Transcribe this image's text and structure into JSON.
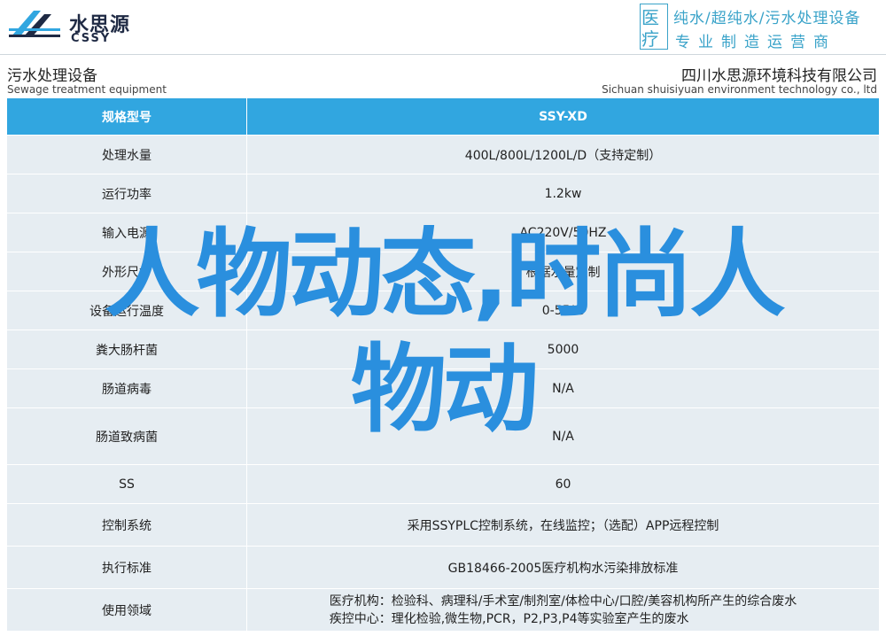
{
  "brand": {
    "name_cn": "水思源",
    "name_en": "CSSY",
    "seal_text": [
      "医",
      "疗"
    ],
    "tagline_1": "纯水/超纯水/污水处理设备",
    "tagline_2": "专业制造运营商"
  },
  "product_header": {
    "title_cn": "污水处理设备",
    "title_en": "Sewage treatment equipment",
    "company_cn": "四川水思源环境科技有限公司",
    "company_en": "Sichuan shuisiyuan environment technology co., ltd"
  },
  "table": {
    "header": [
      "规格型号",
      "SSY-XD"
    ],
    "rows": [
      [
        "处理水量",
        "400L/800L/1200L/D（支持定制）"
      ],
      [
        "运行功率",
        "1.2kw"
      ],
      [
        "输入电源",
        "AC220V/50HZ"
      ],
      [
        "外形尺寸",
        "根据水量定制"
      ],
      [
        "设备运行温度",
        "0-55℃"
      ],
      [
        "粪大肠杆菌",
        "5000"
      ],
      [
        "肠道病毒",
        "N/A"
      ],
      [
        "肠道致病菌",
        "N/A"
      ],
      [
        "SS",
        "60"
      ],
      [
        "控制系统",
        "采用SSYPLC控制系统，在线监控；（选配）APP远程控制"
      ],
      [
        "执行标准",
        "GB18466-2005医疗机构水污染排放标准"
      ],
      [
        "使用领域",
        "医疗机构：检验科、病理科/手术室/制剂室/体检中心/口腔/美容机构所产生的综合废水",
        "疾控中心：理化检验,微生物,PCR，P2,P3,P4等实验室产生的废水"
      ]
    ]
  },
  "overlay_text": {
    "line1": "人物动态,时尚人",
    "line2": "物动"
  },
  "colors": {
    "accent": "#31a6e0",
    "row_bg": "#e6edf2",
    "overlay": "#2a8fde"
  }
}
